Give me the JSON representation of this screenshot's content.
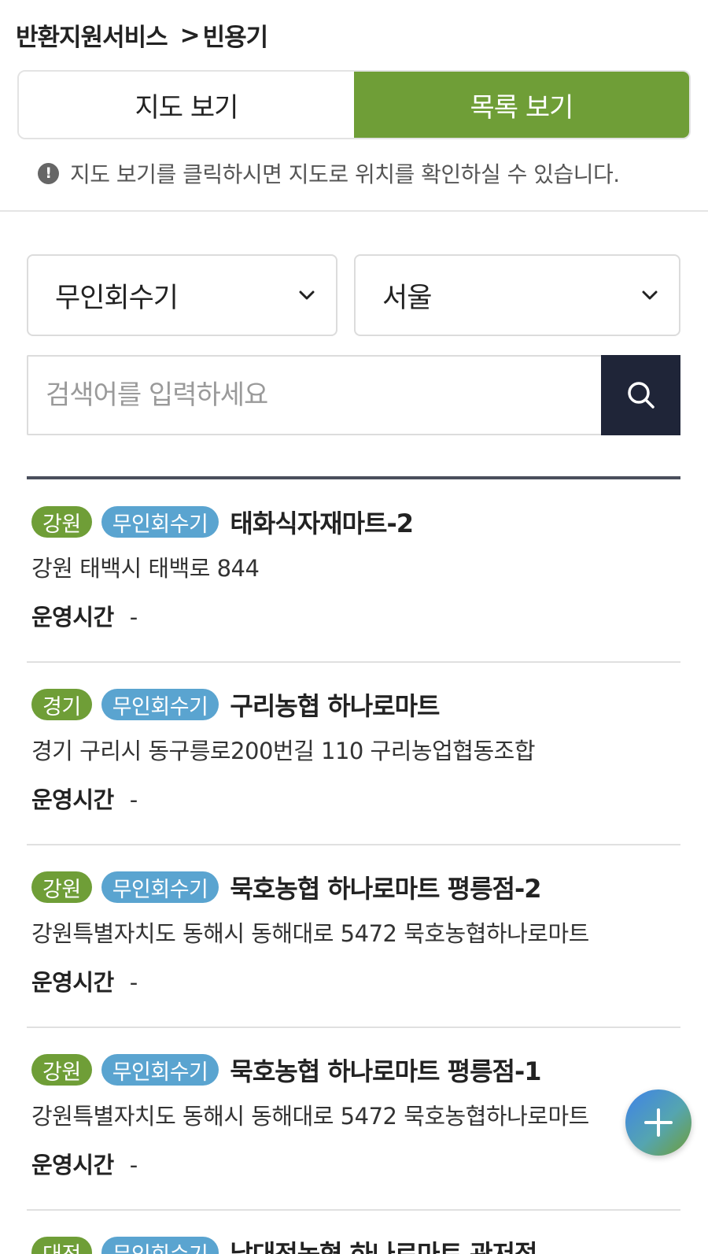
{
  "breadcrumb": {
    "parent": "반환지원서비스",
    "separator": ">",
    "current": "빈용기"
  },
  "view_tabs": [
    {
      "label": "지도 보기",
      "active": false
    },
    {
      "label": "목록 보기",
      "active": true
    }
  ],
  "notice": {
    "icon": "exclamation-circle-icon",
    "text": "지도 보기를 클릭하시면 지도로 위치를 확인하실 수 있습니다."
  },
  "filters": {
    "type_select": {
      "value": "무인회수기"
    },
    "region_select": {
      "value": "서울"
    }
  },
  "search": {
    "placeholder": "검색어를 입력하세요",
    "value": ""
  },
  "colors": {
    "accent_green": "#6f9e37",
    "badge_blue": "#5aa4d0",
    "search_button": "#1f2538"
  },
  "hours_label": "운영시간",
  "items": [
    {
      "region": "강원",
      "kind": "무인회수기",
      "name": "태화식자재마트-2",
      "address": "강원 태백시 태백로 844",
      "hours": "-"
    },
    {
      "region": "경기",
      "kind": "무인회수기",
      "name": "구리농협 하나로마트",
      "address": "경기 구리시 동구릉로200번길 110 구리농업협동조합",
      "hours": "-"
    },
    {
      "region": "강원",
      "kind": "무인회수기",
      "name": "묵호농협 하나로마트 평릉점-2",
      "address": "강원특별자치도 동해시 동해대로 5472 묵호농협하나로마트",
      "hours": "-"
    },
    {
      "region": "강원",
      "kind": "무인회수기",
      "name": "묵호농협 하나로마트 평릉점-1",
      "address": "강원특별자치도 동해시 동해대로 5472 묵호농협하나로마트",
      "hours": "-"
    },
    {
      "region": "대전",
      "kind": "무인회수기",
      "name": "남대전농협 하나로마트 관저점",
      "address": "",
      "hours": ""
    }
  ],
  "fab": {
    "icon": "plus-icon"
  }
}
